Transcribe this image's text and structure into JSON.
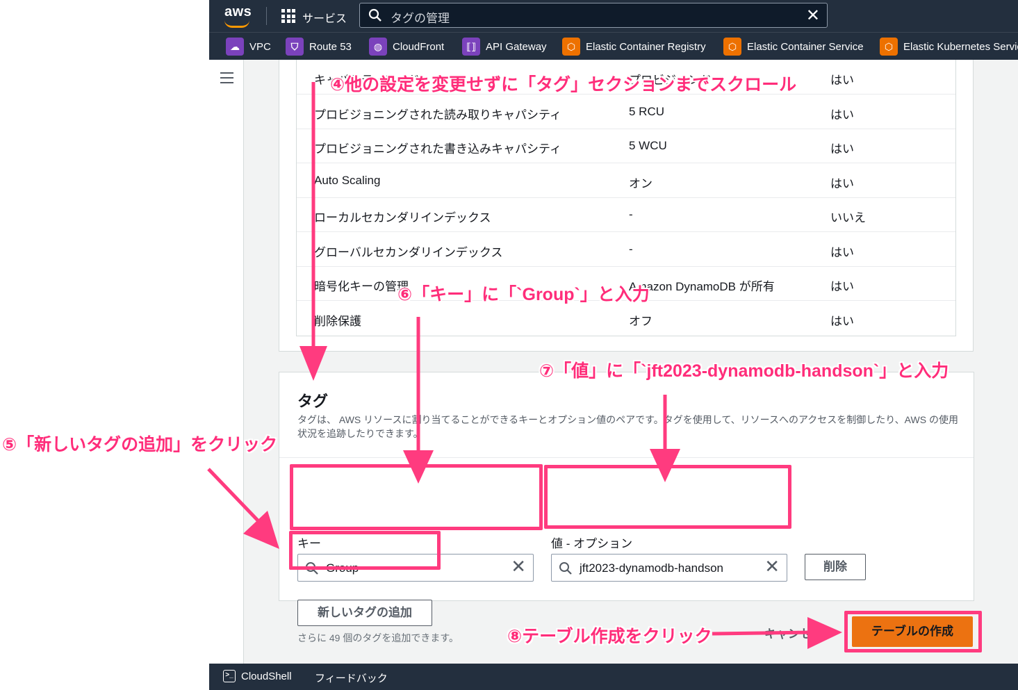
{
  "topnav": {
    "logo": "aws",
    "services_label": "サービス",
    "search_value": "タグの管理",
    "search_clear": "✕"
  },
  "favorites": [
    {
      "label": "VPC",
      "icon": "vpc-icon",
      "color": "#7b42bc"
    },
    {
      "label": "Route 53",
      "icon": "route53-icon",
      "color": "#7b42bc"
    },
    {
      "label": "CloudFront",
      "icon": "cloudfront-icon",
      "color": "#7b42bc"
    },
    {
      "label": "API Gateway",
      "icon": "api-gateway-icon",
      "color": "#7b42bc"
    },
    {
      "label": "Elastic Container Registry",
      "icon": "ecr-icon",
      "color": "#ed7100"
    },
    {
      "label": "Elastic Container Service",
      "icon": "ecs-icon",
      "color": "#ed7100"
    },
    {
      "label": "Elastic Kubernetes Servic",
      "icon": "eks-icon",
      "color": "#ed7100"
    }
  ],
  "settings_table": {
    "rows": [
      {
        "name": "キャパシティモード",
        "value": "プロビジョンド",
        "editable": "はい"
      },
      {
        "name": "プロビジョニングされた読み取りキャパシティ",
        "value": "5 RCU",
        "editable": "はい"
      },
      {
        "name": "プロビジョニングされた書き込みキャパシティ",
        "value": "5 WCU",
        "editable": "はい"
      },
      {
        "name": "Auto Scaling",
        "value": "オン",
        "editable": "はい"
      },
      {
        "name": "ローカルセカンダリインデックス",
        "value": "-",
        "editable": "いいえ"
      },
      {
        "name": "グローバルセカンダリインデックス",
        "value": "-",
        "editable": "はい"
      },
      {
        "name": "暗号化キーの管理",
        "value": "Amazon DynamoDB が所有",
        "editable": "はい"
      },
      {
        "name": "削除保護",
        "value": "オフ",
        "editable": "はい"
      }
    ]
  },
  "tags": {
    "title": "タグ",
    "description": "タグは、 AWS リソースに割り当てることができるキーとオプション値のペアです。タグを使用して、リソースへのアクセスを制御したり、AWS の使用状況を追跡したりできます。",
    "key_label": "キー",
    "key_value": "Group",
    "value_label": "値 - オプション",
    "value_value": "jft2023-dynamodb-handson",
    "remove_button": "削除",
    "add_button": "新しいタグの追加",
    "remaining_text": "さらに 49 個のタグを追加できます。"
  },
  "actions": {
    "cancel": "キャンセル",
    "create": "テーブルの作成"
  },
  "footer": {
    "cloudshell": "CloudShell",
    "feedback": "フィードバック"
  },
  "annotations": {
    "step4": "④他の設定を変更せずに「タグ」セクションまでスクロール",
    "step5": "⑤「新しいタグの追加」をクリック",
    "step6": "⑥「キー」に「`Group`」と入力",
    "step7": "⑦「値」に「`jft2023-dynamodb-handson`」と入力",
    "step8": "⑧テーブル作成をクリック",
    "color": "#ff2d7a"
  }
}
